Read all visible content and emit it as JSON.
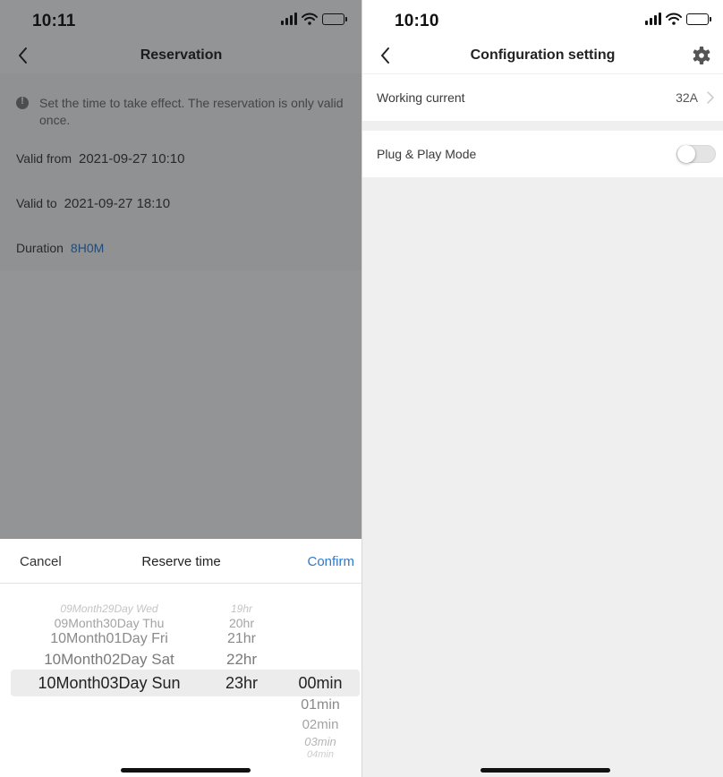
{
  "left": {
    "status": {
      "time": "10:11"
    },
    "nav": {
      "title": "Reservation"
    },
    "notice": "Set the time to take effect. The reservation is only valid once.",
    "valid_from": {
      "label": "Valid from",
      "value": "2021-09-27 10:10"
    },
    "valid_to": {
      "label": "Valid to",
      "value": "2021-09-27 18:10"
    },
    "duration": {
      "label": "Duration",
      "value": "8H0M"
    },
    "picker": {
      "cancel_label": "Cancel",
      "title": "Reserve time",
      "confirm_label": "Confirm",
      "dates": [
        "09Month29Day Wed",
        "09Month30Day Thu",
        "10Month01Day Fri",
        "10Month02Day Sat",
        "10Month03Day Sun"
      ],
      "hours": [
        "19hr",
        "20hr",
        "21hr",
        "22hr",
        "23hr"
      ],
      "minutes": [
        "00min",
        "01min",
        "02min",
        "03min",
        "04min"
      ]
    }
  },
  "right": {
    "status": {
      "time": "10:10"
    },
    "nav": {
      "title": "Configuration setting"
    },
    "working_current": {
      "label": "Working current",
      "value": "32A"
    },
    "plug_play": {
      "label": "Plug & Play Mode",
      "enabled": false
    }
  },
  "colors": {
    "accent": "#2e79c9",
    "dim_overlay": "#14161a",
    "separator": "#efefef"
  },
  "icons": [
    "signal-icon",
    "wifi-icon",
    "battery-icon",
    "back-chevron-icon",
    "gear-icon",
    "info-icon",
    "chevron-right-icon"
  ]
}
